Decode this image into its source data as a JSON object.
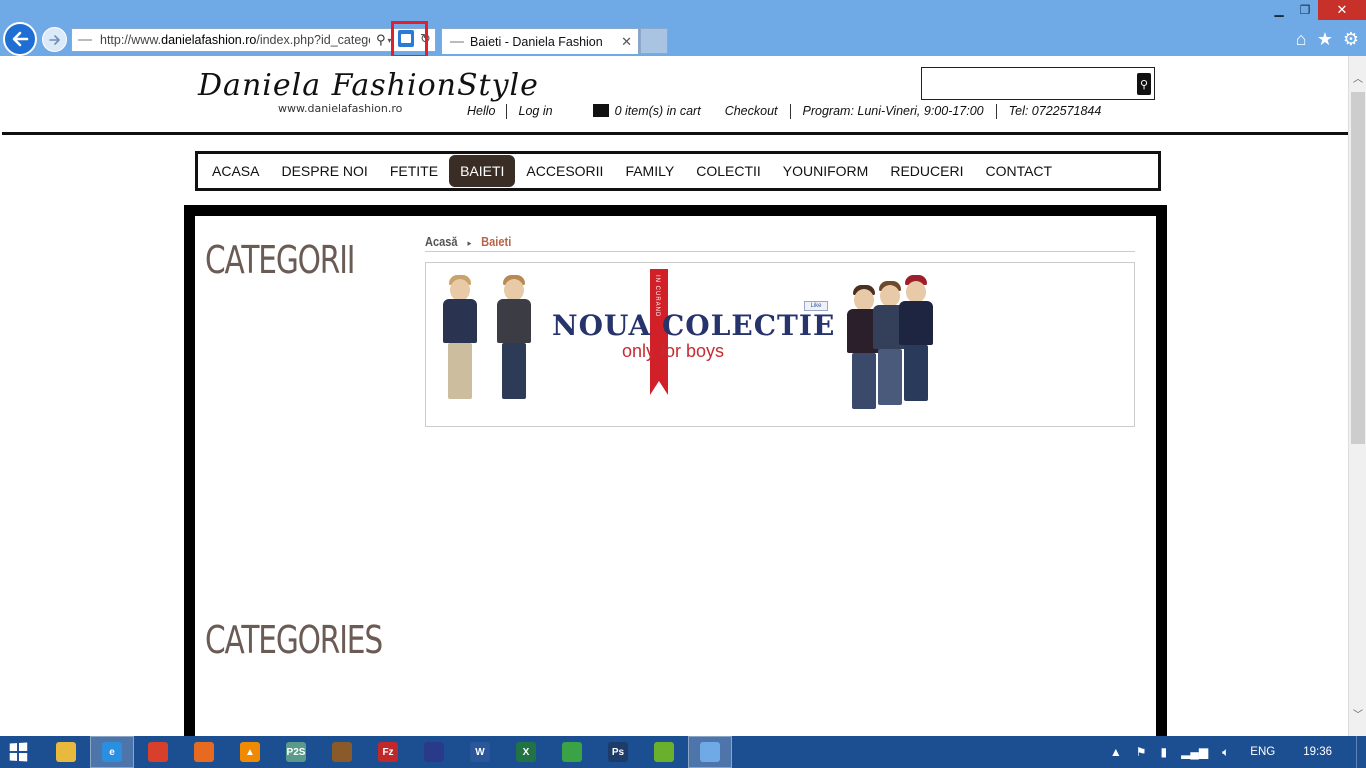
{
  "browser": {
    "url_prefix": "http://www.",
    "url_domain": "danielafashion.ro",
    "url_rest": "/index.php?id_catego",
    "tab_title": "Baieti - Daniela Fashion",
    "window_controls": {
      "minimize": "▁",
      "maximize": "❐",
      "close": "✕"
    },
    "icons": [
      "back-arrow-icon",
      "forward-arrow-icon",
      "search-icon",
      "compatibility-view-icon",
      "refresh-icon",
      "home-icon",
      "favorites-star-icon",
      "gear-icon"
    ]
  },
  "site": {
    "logo": {
      "script": "Daniela FashionStyle",
      "url": "www.danielafashion.ro"
    },
    "search": {
      "value": "",
      "placeholder": ""
    },
    "top_links": {
      "hello": "Hello",
      "login": "Log in",
      "cart": "0 item(s) in cart",
      "checkout": "Checkout",
      "program": "Program: Luni-Vineri, 9:00-17:00",
      "tel": "Tel: 0722571844"
    },
    "nav": {
      "items": [
        "ACASA",
        "DESPRE NOI",
        "FETITE",
        "BAIETI",
        "ACCESORII",
        "FAMILY",
        "COLECTII",
        "YOUNIFORM",
        "REDUCERI",
        "CONTACT"
      ],
      "active": "BAIETI"
    },
    "sidebar": {
      "heading_1": "CATEGORII",
      "heading_2": "CATEGORIES"
    },
    "breadcrumb": {
      "home": "Acasă",
      "separator": "▸",
      "current": "Baieti"
    },
    "banner": {
      "title": "NOUA COLECTIE",
      "subtitle": "only for boys",
      "ribbon": "IN CURAND",
      "like": "Like"
    },
    "colors": {
      "accent_nav_active": "#3a2d26",
      "breadcrumb_current": "#b5654a",
      "heading": "#6b5b55",
      "banner_title": "#27336b",
      "banner_red": "#d22028"
    }
  },
  "taskbar": {
    "apps": [
      {
        "name": "file-explorer",
        "glyph": "",
        "color": "#e8b93c"
      },
      {
        "name": "internet-explorer",
        "glyph": "e",
        "color": "#2b8fe0",
        "active": true
      },
      {
        "name": "chrome",
        "glyph": "",
        "color": "#d9402b"
      },
      {
        "name": "firefox",
        "glyph": "",
        "color": "#e66a1f"
      },
      {
        "name": "vlc",
        "glyph": "▲",
        "color": "#f08a00"
      },
      {
        "name": "app-p2s",
        "glyph": "P2S",
        "color": "#5a9a8a"
      },
      {
        "name": "winrar",
        "glyph": "",
        "color": "#8a5a2a"
      },
      {
        "name": "filezilla",
        "glyph": "Fz",
        "color": "#c0282a"
      },
      {
        "name": "save-app",
        "glyph": "",
        "color": "#2a3a8a"
      },
      {
        "name": "word",
        "glyph": "W",
        "color": "#2b579a"
      },
      {
        "name": "excel",
        "glyph": "X",
        "color": "#217346"
      },
      {
        "name": "dreamweaver-app",
        "glyph": "",
        "color": "#3aa346"
      },
      {
        "name": "photoshop",
        "glyph": "Ps",
        "color": "#1d3c6a"
      },
      {
        "name": "utorrent",
        "glyph": "",
        "color": "#6ab02d"
      },
      {
        "name": "paint-app",
        "glyph": "",
        "color": "#6fa9e6",
        "active": true
      }
    ],
    "tray": {
      "lang": "ENG",
      "time": "19:36"
    }
  }
}
